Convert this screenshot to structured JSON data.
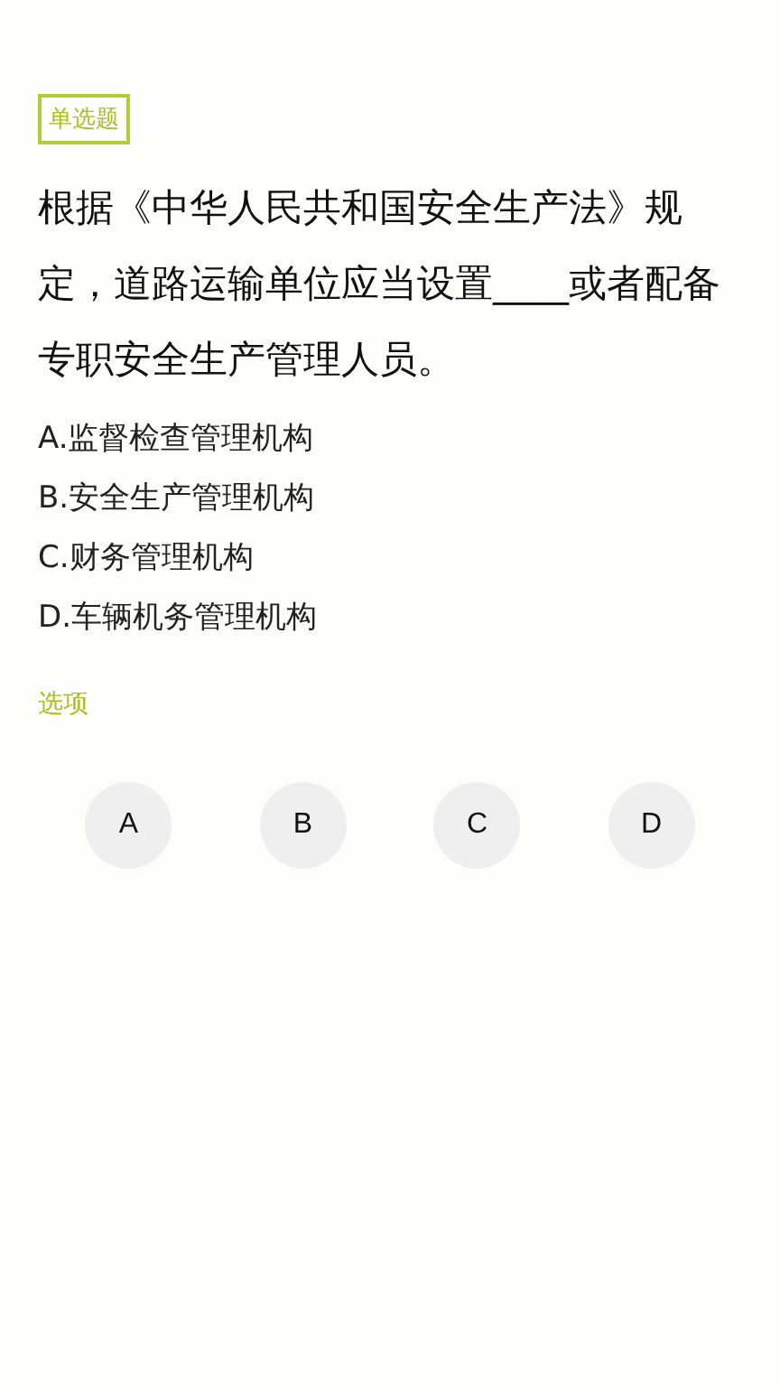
{
  "question_type": "单选题",
  "question": "根据《中华人民共和国安全生产法》规定，道路运输单位应当设置____或者配备专职安全生产管理人员。",
  "options": [
    "A.监督检查管理机构",
    "B.安全生产管理机构",
    "C.财务管理机构",
    "D.车辆机务管理机构"
  ],
  "answer_label": "选项",
  "answer_buttons": [
    "A",
    "B",
    "C",
    "D"
  ]
}
